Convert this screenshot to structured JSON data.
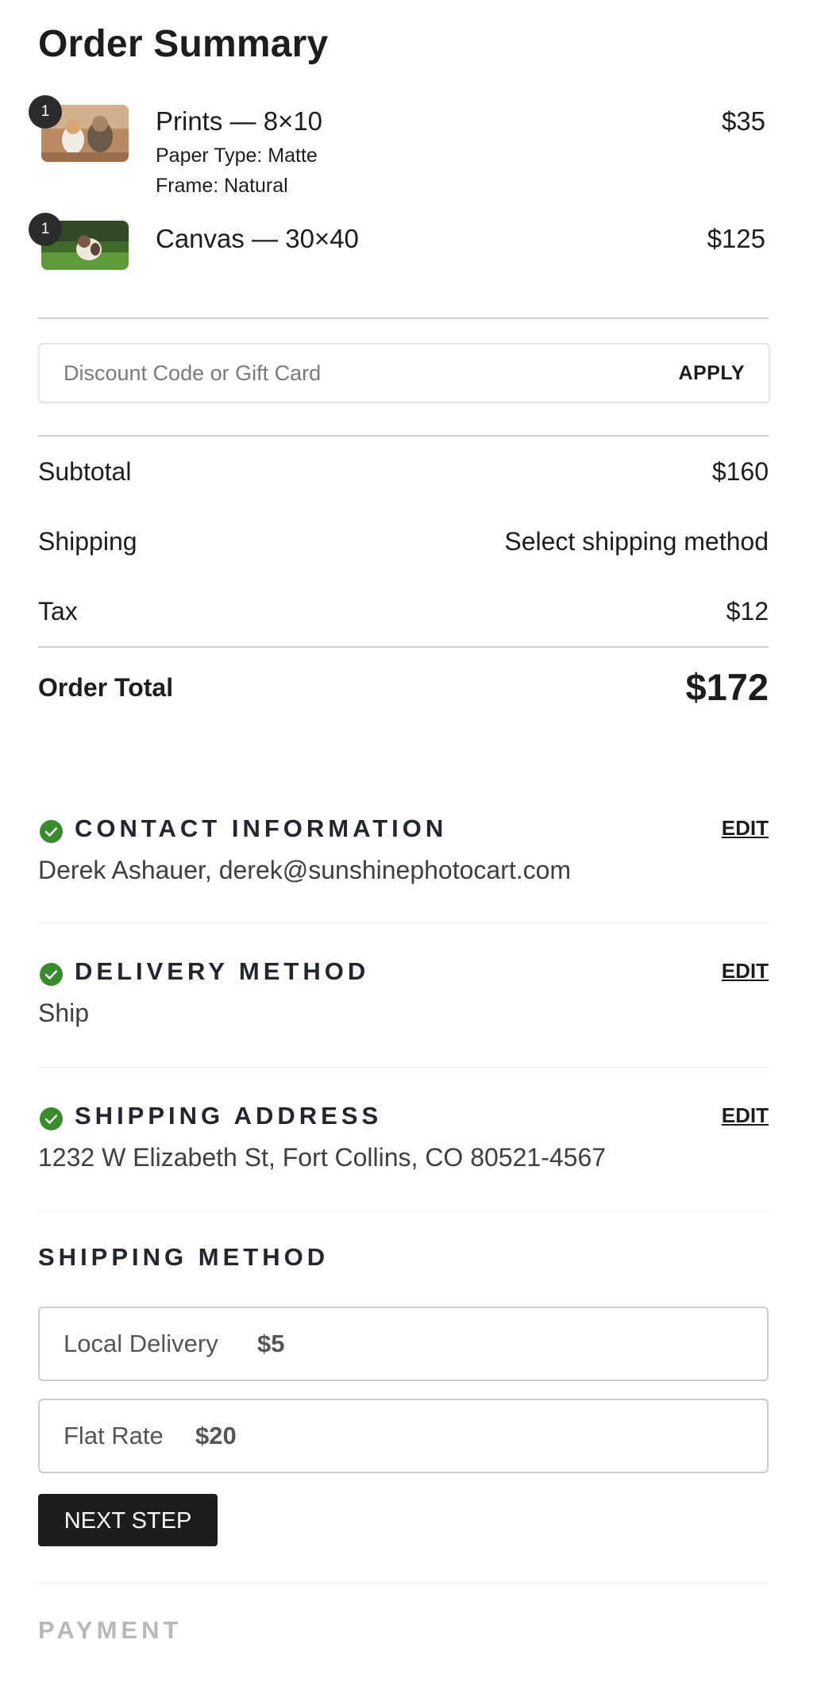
{
  "order_summary": {
    "title": "Order Summary",
    "items": [
      {
        "qty": "1",
        "name": "Prints — 8×10",
        "price": "$35",
        "options": [
          "Paper Type: Matte",
          "Frame: Natural"
        ],
        "thumb_icon": "dogs-photo-thumbnail"
      },
      {
        "qty": "1",
        "name": "Canvas — 30×40",
        "price": "$125",
        "options": [],
        "thumb_icon": "dog-on-grass-thumbnail"
      }
    ],
    "discount": {
      "placeholder": "Discount Code or Gift Card",
      "apply_label": "APPLY"
    },
    "subtotal": {
      "label": "Subtotal",
      "value": "$160"
    },
    "shipping": {
      "label": "Shipping",
      "value": "Select shipping method"
    },
    "tax": {
      "label": "Tax",
      "value": "$12"
    },
    "total": {
      "label": "Order Total",
      "value": "$172"
    }
  },
  "sections": [
    {
      "title": "CONTACT INFORMATION",
      "edit": "EDIT",
      "value": "Derek Ashauer, derek@sunshinephotocart.com",
      "status_icon": "check-circle-icon"
    },
    {
      "title": "DELIVERY METHOD",
      "edit": "EDIT",
      "value": "Ship",
      "status_icon": "check-circle-icon"
    },
    {
      "title": "SHIPPING ADDRESS",
      "edit": "EDIT",
      "value": "1232 W Elizabeth St, Fort Collins, CO 80521-4567",
      "status_icon": "check-circle-icon"
    }
  ],
  "shipping_method": {
    "title": "SHIPPING METHOD",
    "options": [
      {
        "name": "Local Delivery",
        "price": "$5"
      },
      {
        "name": "Flat Rate",
        "price": "$20"
      }
    ],
    "next_label": "NEXT STEP"
  },
  "payment": {
    "title": "PAYMENT"
  },
  "colors": {
    "check_green": "#3a8a2e",
    "button_dark": "#1d1d1d",
    "muted_heading": "#b8b8b8"
  }
}
